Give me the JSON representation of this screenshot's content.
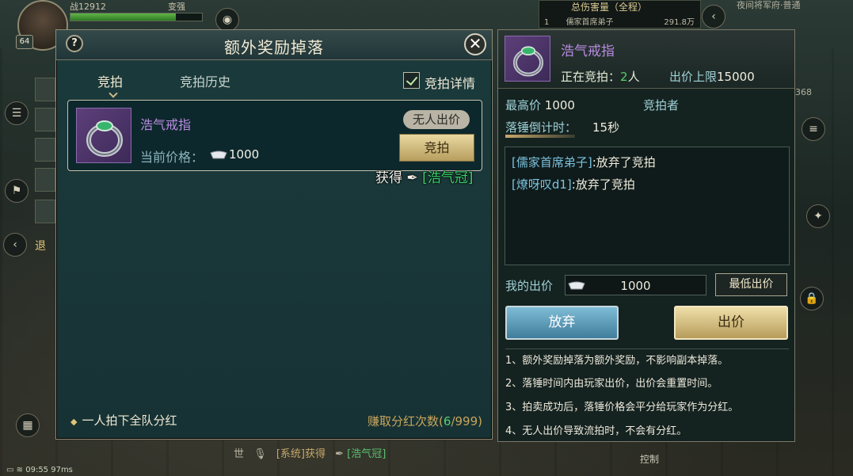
{
  "hud": {
    "power": "战12912",
    "level": "64",
    "upgrade_label": "变强",
    "damage_panel_title": "总伤害量（全程）",
    "damage_rank": "1",
    "damage_player": "儒家首席弟子",
    "damage_value": "291.8万",
    "location": "夜间将军府·普通",
    "exit_label": "退",
    "side_number": "368",
    "time_status": "09:55  97ms",
    "chat_channel": "世",
    "chat_prefix": "[系统]获得",
    "chat_item": "[浩气冠]",
    "control_label": "控制"
  },
  "auction_panel": {
    "title": "额外奖励掉落",
    "help_label": "?",
    "close_label": "✕",
    "tabs": [
      {
        "label": "竞拍",
        "active": true
      },
      {
        "label": "竞拍历史",
        "active": false
      }
    ],
    "details_label": "竞拍详情",
    "details_checked": true,
    "item": {
      "name": "浩气戒指",
      "price_label": "当前价格：",
      "price": "1000",
      "status_badge": "无人出价",
      "bid_button": "竞拍"
    },
    "obtain_float": {
      "prefix": "获得",
      "item": "[浩气冠]"
    },
    "footer_note": "一人拍下全队分红",
    "dividend_label": "赚取分红次数",
    "dividend_open": "(",
    "dividend_current": "6",
    "dividend_sep": "/",
    "dividend_max": "999",
    "dividend_close": ")"
  },
  "detail_panel": {
    "item_name": "浩气戒指",
    "bidding_label": "正在竞拍：",
    "bidding_count": "2",
    "bidding_unit": "人",
    "limit_label": "出价上限",
    "limit_value": "15000",
    "highest_label": "最高价",
    "highest_value": "1000",
    "bidder_label": "竞拍者",
    "countdown_label": "落锤倒计时：",
    "countdown_value": "15秒",
    "log": [
      {
        "who": "[儒家首席弟子]",
        "text": ":放弃了竞拍"
      },
      {
        "who": "[燎呀叹d1]",
        "text": ":放弃了竞拍"
      }
    ],
    "my_bid_label": "我的出价",
    "my_bid_value": "1000",
    "min_bid_button": "最低出价",
    "give_up_button": "放弃",
    "place_bid_button": "出价",
    "rules": [
      "1、额外奖励掉落为额外奖励，不影响副本掉落。",
      "2、落锤时间内由玩家出价，出价会重置时间。",
      "3、拍卖成功后，落锤价格会平分给玩家作为分红。",
      "4、无人出价导致流拍时，不会有分红。"
    ]
  },
  "colors": {
    "item_purple": "#b88be0",
    "label_cyan": "#9fd1d7",
    "count_green": "#56d06a",
    "gold_button": "#b79c5b",
    "blue_button": "#3f7d9b"
  }
}
